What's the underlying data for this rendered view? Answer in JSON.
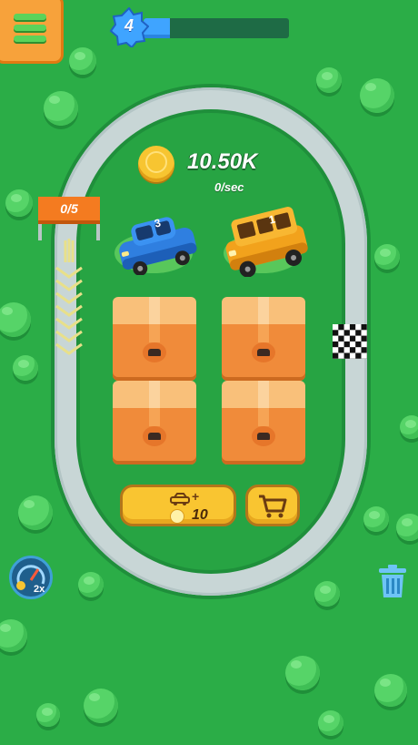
{
  "hud": {
    "level": "4",
    "level_progress": 0.18
  },
  "economy": {
    "money": "10.50K",
    "rate": "0/sec"
  },
  "lap_banner": "0/5",
  "cars": [
    {
      "level": "3",
      "color": "#2f7fe0"
    },
    {
      "level": "1",
      "color": "#f2a21c"
    }
  ],
  "boxes_count": 4,
  "buy_car_button": {
    "plus": "+",
    "price": "10"
  },
  "speed_boost": {
    "label": "2x"
  },
  "icons": {
    "menu": "hamburger-menu-icon",
    "shop": "shopping-cart-icon",
    "trash": "trash-can-icon",
    "speed": "speedometer-icon",
    "coin": "coin-icon"
  },
  "colors": {
    "grass": "#2bad47",
    "track": "#c8d6d6",
    "button_yellow": "#f9c531",
    "menu_orange": "#f7a23b",
    "progress_blue": "#3fa4ff"
  }
}
